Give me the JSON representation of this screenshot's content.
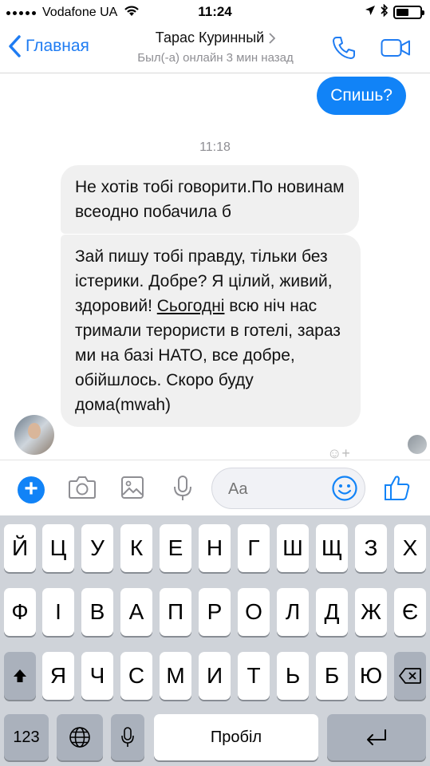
{
  "status_bar": {
    "carrier": "Vodafone UA",
    "time": "11:24"
  },
  "nav": {
    "back_label": "Главная",
    "contact_name": "Тарас Куринный",
    "contact_status": "Был(-а) онлайн 3 мин назад"
  },
  "chat": {
    "outgoing_message": "Спишь?",
    "time_separator": "11:18",
    "incoming_message_1": "Не хотів тобі говорити.По новинам всеодно побачила б",
    "incoming_message_2_part1": "Зай пишу тобі правду, тільки без істерики. Добре? Я цілий, живий, здоровий! ",
    "incoming_message_2_link": "Сьогодні",
    "incoming_message_2_part2": " всю ніч нас тримали терористи в готелі, зараз ми на базі НАТО, все добре, обійшлось. Скоро буду дома(mwah)"
  },
  "composer": {
    "placeholder": "Aa"
  },
  "keyboard": {
    "row1": [
      "Й",
      "Ц",
      "У",
      "К",
      "Е",
      "Н",
      "Г",
      "Ш",
      "Щ",
      "З",
      "Х"
    ],
    "row2": [
      "Ф",
      "І",
      "В",
      "А",
      "П",
      "Р",
      "О",
      "Л",
      "Д",
      "Ж",
      "Є"
    ],
    "row3": [
      "Я",
      "Ч",
      "С",
      "М",
      "И",
      "Т",
      "Ь",
      "Б",
      "Ю"
    ],
    "numbers_key": "123",
    "space_key": "Пробіл"
  },
  "colors": {
    "accent": "#1183f7",
    "incoming_bubble": "#f0f0f0",
    "keyboard_bg": "#cfd3d9"
  }
}
